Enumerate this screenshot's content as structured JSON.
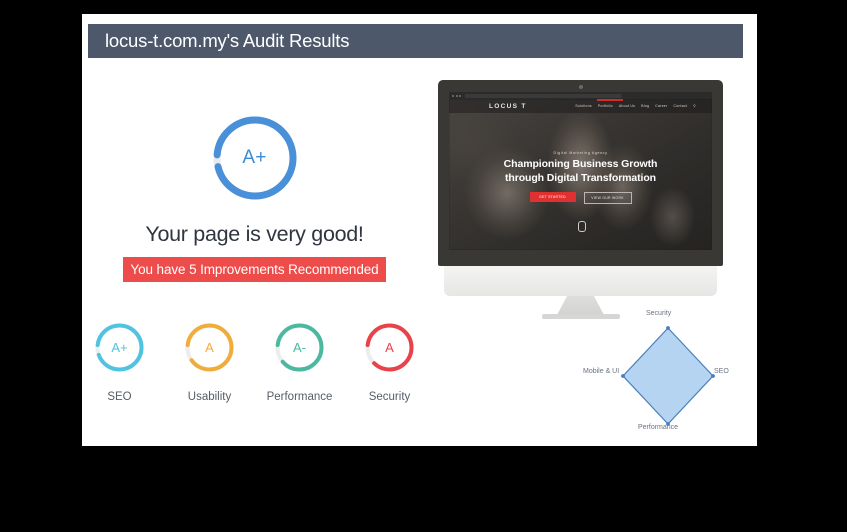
{
  "header": {
    "title": "locus-t.com.my's Audit Results",
    "bar_color": "#4d586b"
  },
  "overall": {
    "grade": "A+",
    "grade_color": "#3d8bd4",
    "ring_color": "#4a90d9",
    "verdict": "Your page is very good!",
    "improvements_banner": "You have 5 Improvements Recommended",
    "banner_color": "#ee4b4b"
  },
  "subgauges": [
    {
      "grade": "A+",
      "name": "SEO",
      "color": "#4fc3e0"
    },
    {
      "grade": "A",
      "name": "Usability",
      "color": "#f0ad3c"
    },
    {
      "grade": "A-",
      "name": "Performance",
      "color": "#4cb8a0"
    },
    {
      "grade": "A",
      "name": "Security",
      "color": "#e8434a"
    }
  ],
  "preview": {
    "logo": "LOCUS T",
    "nav_items": [
      "Solutions",
      "Portfolio",
      "About Us",
      "Blog",
      "Career",
      "Contact"
    ],
    "search_icon": "search-icon",
    "hero_eyebrow": "Digital Marketing Agency",
    "hero_title_line1": "Championing Business Growth",
    "hero_title_line2": "through Digital Transformation",
    "hero_button_primary": "GET STARTED",
    "hero_button_secondary": "VIEW OUR WORK",
    "accent_color": "#d32a2a"
  },
  "chart_data": {
    "type": "radar",
    "title": "",
    "categories": [
      "Security",
      "SEO",
      "Performance",
      "Mobile & UI"
    ],
    "values": [
      100,
      100,
      100,
      100
    ],
    "rlim": [
      0,
      100
    ],
    "grid": false,
    "legend": "none",
    "fill_color": "#a8cdf0",
    "line_color": "#4a7ebb",
    "axis_order": [
      "top",
      "right",
      "bottom",
      "left"
    ]
  }
}
